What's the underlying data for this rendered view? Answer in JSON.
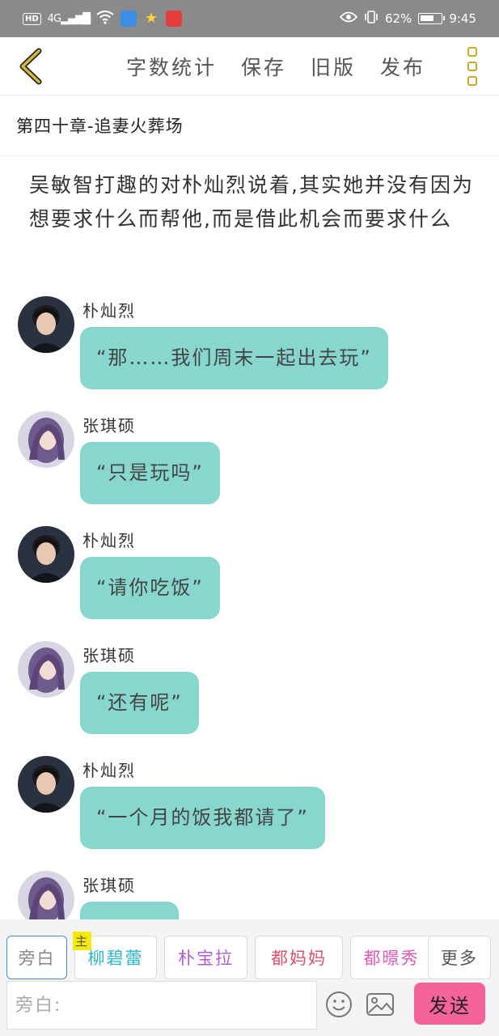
{
  "status_bar": {
    "network": "4G",
    "battery_percent": "62%",
    "time": "9:45",
    "icons": [
      "hd-icon",
      "signal-icon",
      "wifi-icon",
      "app-icon",
      "star-icon",
      "app-red-icon",
      "eye-icon",
      "vibrate-icon",
      "battery-icon"
    ]
  },
  "toolbar": {
    "back_icon": "chevron-left-icon",
    "actions": [
      {
        "label": "字数统计"
      },
      {
        "label": "保存"
      },
      {
        "label": "旧版"
      },
      {
        "label": "发布"
      }
    ],
    "more_icon": "more-vertical-icon",
    "accent_color": "#c9a92c"
  },
  "chapter": {
    "title": "第四十章-追妻火葬场"
  },
  "narration": "吴敏智打趣的对朴灿烈说着,其实她并没有因为想要求什么而帮他,而是借此机会而要求什么",
  "messages": [
    {
      "sender": "朴灿烈",
      "text": "“那……我们周末一起出去玩”",
      "avatar": "male"
    },
    {
      "sender": "张琪硕",
      "text": "“只是玩吗”",
      "avatar": "female"
    },
    {
      "sender": "朴灿烈",
      "text": "“请你吃饭”",
      "avatar": "male"
    },
    {
      "sender": "张琪硕",
      "text": "“还有呢”",
      "avatar": "female"
    },
    {
      "sender": "朴灿烈",
      "text": "“一个月的饭我都请了”",
      "avatar": "male"
    },
    {
      "sender": "张琪硕",
      "text": "",
      "avatar": "female"
    }
  ],
  "bubble_color": "#87d7cf",
  "characters": [
    {
      "name": "旁白",
      "color": "#888888",
      "selected": true
    },
    {
      "name": "柳碧蕾",
      "color": "#2bb6c9",
      "main_tag": "主"
    },
    {
      "name": "朴宝拉",
      "color": "#b05fd0"
    },
    {
      "name": "都妈妈",
      "color": "#e0506a"
    },
    {
      "name": "都暻秀",
      "color": "#e05ab4"
    },
    {
      "name": "更多",
      "color": "#555555"
    }
  ],
  "input": {
    "placeholder": "旁白:"
  },
  "send_button": {
    "label": "发送",
    "color": "#f4639a"
  }
}
